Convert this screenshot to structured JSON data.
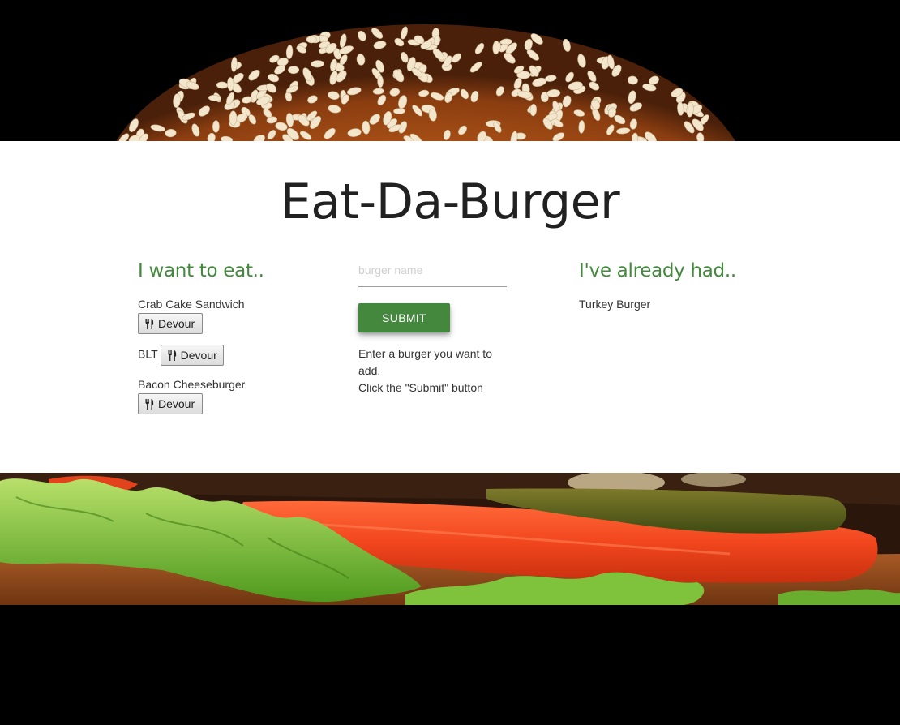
{
  "site": {
    "title": "Eat-Da-Burger"
  },
  "want_column": {
    "heading": "I want to eat..",
    "devour_label": "Devour",
    "items": [
      {
        "name": "Crab Cake Sandwich"
      },
      {
        "name": "BLT"
      },
      {
        "name": "Bacon Cheeseburger"
      }
    ]
  },
  "form": {
    "placeholder": "burger name",
    "value": "",
    "submit_label": "SUBMIT",
    "hint_line1": "Enter a burger you want to add.",
    "hint_line2": "Click the \"Submit\" button"
  },
  "had_column": {
    "heading": "I've already had..",
    "items": [
      {
        "name": "Turkey Burger"
      }
    ]
  },
  "icons": {
    "devour": "fork-knife-icon"
  },
  "colors": {
    "accent": "#43883c",
    "title": "#212121",
    "panel": "#ffffff",
    "background": "#000000"
  }
}
